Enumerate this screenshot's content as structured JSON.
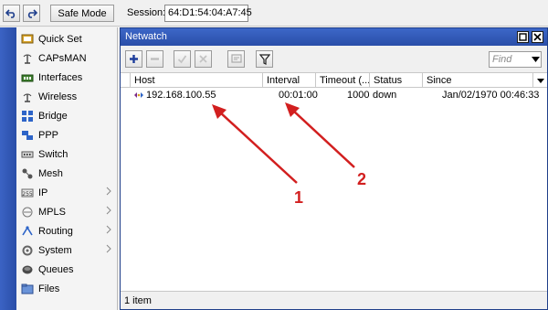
{
  "toolbar": {
    "undo_icon": "undo-icon",
    "redo_icon": "redo-icon",
    "safe_mode_label": "Safe Mode",
    "session_label": "Session:",
    "session_value": "64:D1:54:04:A7:45"
  },
  "sidebar": {
    "items": [
      {
        "label": "Quick Set",
        "icon": "quick-set-icon",
        "submenu": false
      },
      {
        "label": "CAPsMAN",
        "icon": "capsman-icon",
        "submenu": false
      },
      {
        "label": "Interfaces",
        "icon": "interfaces-icon",
        "submenu": false
      },
      {
        "label": "Wireless",
        "icon": "wireless-icon",
        "submenu": false
      },
      {
        "label": "Bridge",
        "icon": "bridge-icon",
        "submenu": false
      },
      {
        "label": "PPP",
        "icon": "ppp-icon",
        "submenu": false
      },
      {
        "label": "Switch",
        "icon": "switch-icon",
        "submenu": false
      },
      {
        "label": "Mesh",
        "icon": "mesh-icon",
        "submenu": false
      },
      {
        "label": "IP",
        "icon": "ip-icon",
        "submenu": true
      },
      {
        "label": "MPLS",
        "icon": "mpls-icon",
        "submenu": true
      },
      {
        "label": "Routing",
        "icon": "routing-icon",
        "submenu": true
      },
      {
        "label": "System",
        "icon": "system-icon",
        "submenu": true
      },
      {
        "label": "Queues",
        "icon": "queues-icon",
        "submenu": false
      },
      {
        "label": "Files",
        "icon": "files-icon",
        "submenu": false
      }
    ]
  },
  "window": {
    "title": "Netwatch",
    "find_placeholder": "Find",
    "columns": [
      "Host",
      "Interval",
      "Timeout (...",
      "Status",
      "Since"
    ],
    "rows": [
      {
        "host": "192.168.100.55",
        "interval": "00:01:00",
        "timeout": "1000",
        "status": "down",
        "since": "Jan/02/1970 00:46:33"
      }
    ],
    "footer": "1 item"
  },
  "annotations": {
    "label_1": "1",
    "label_2": "2",
    "color": "#d21f1f"
  }
}
